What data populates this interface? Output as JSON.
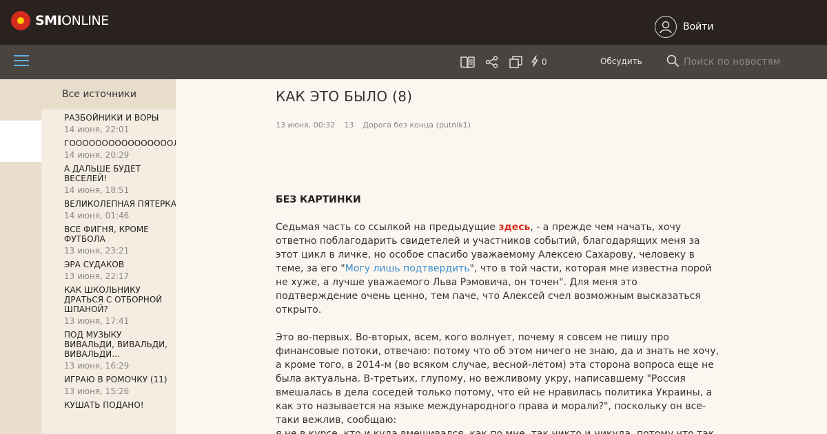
{
  "header": {
    "logo_bold": "SMI",
    "logo_light": "ONLINE",
    "login_label": "Войти"
  },
  "toolbar": {
    "counter": "0",
    "discuss_label": "Обсудить",
    "search_placeholder": "Поиск по новостям",
    "icons": [
      "book-icon",
      "share-icon",
      "copy-icon",
      "lightning-icon",
      "search-icon",
      "menu-icon",
      "user-icon"
    ]
  },
  "colors": {
    "header_bg": "#2a221e",
    "navbar_bg": "#4a4440",
    "accent_red": "#d52b1e",
    "link_blue": "#3d8dd0",
    "menu_blue": "#5bb3e6"
  },
  "sidebar": {
    "heading": "Все источники",
    "items": [
      {
        "title": "РАЗБОЙНИКИ И ВОРЫ",
        "date": "14 июня, 22:01"
      },
      {
        "title": "ГООООООООООООООООЛ",
        "date": "14 июня, 20:29"
      },
      {
        "title": "А ДАЛЬШЕ БУДЕТ ВЕСЕЛЕЙ!",
        "date": "14 июня, 18:51"
      },
      {
        "title": "ВЕЛИКОЛЕПНАЯ ПЯТЕРКА",
        "date": "14 июня, 01:46"
      },
      {
        "title": "ВСЕ ФИГНЯ, КРОМЕ ФУТБОЛА",
        "date": "13 июня, 23:21"
      },
      {
        "title": "ЭРА СУДАКОВ",
        "date": "13 июня, 22:17"
      },
      {
        "title": "КАК ШКОЛЬНИКУ ДРАТЬСЯ С ОТБОРНОЙ ШПАНОЙ?",
        "date": "13 июня, 17:41"
      },
      {
        "title": "ПОД МУЗЫКУ ВИВАЛЬДИ, ВИВАЛЬДИ, ВИВАЛЬДИ...",
        "date": "13 июня, 16:29"
      },
      {
        "title": "ИГРАЮ В РОМОЧКУ (11)",
        "date": "13 июня, 15:26"
      },
      {
        "title": "КУШАТЬ ПОДАНО!",
        "date": ""
      }
    ]
  },
  "article": {
    "title": "КАК ЭТО БЫЛО (8)",
    "date": "13 июня, 00:32",
    "views": "13",
    "author": "Дорога без конца (putnik1)",
    "subhead": "БЕЗ КАРТИНКИ",
    "p1_before": "Седьмая часть со ссылкой на предыдущие ",
    "p1_link": "здесь",
    "p1_middle": ", - а прежде чем начать, хочу ответно поблагодарить  свидетелей и участников событий,  благодарящих меня за этот цикл в личке, но особое спасибо уважаемому Алексею Сахарову, человеку в теме, за его \"",
    "p1_link2": "Могу лишь подтвердить",
    "p1_after": "\", что в той части, которая мне известна порой не хуже, а лучше уважаемого Льва Рэмовича, он точен\". Для меня это подтверждение очень ценно, тем паче, что Алексей счел возможным высказаться открыто.",
    "p2": "Это во-первых. Во-вторых, всем, кого волнует, почему я совсем не пишу про финансовые потоки, отвечаю: потому что об этом ничего не знаю, да и знать не хочу, а кроме того, в 2014-м (во всяком случае, весной-летом) эта сторона вопроса еще не была актуальна. В-третьих, глупому, но вежливому укру, написавшему \"Россия вмешалась в дела соседей только потому, что ей не нравилась политика Украины, а как это называется на языке международного права и морали?\", поскольку он все-таки вежлив, сообщаю:",
    "p3": "я не в курсе, кто и куда вмешивался, как по мне, так никто и никуда, потому что так не"
  }
}
